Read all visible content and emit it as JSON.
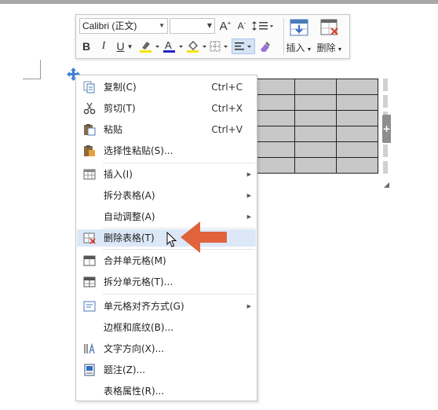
{
  "toolbar": {
    "font_name": "Calibri (正文)",
    "font_size": "",
    "bold": "B",
    "italic": "I",
    "underline": "U",
    "font_color_letter": "A",
    "grow_font": "A",
    "shrink_font": "A",
    "insert_label": "插入",
    "delete_label": "删除",
    "font_color_hex": "#2222cc",
    "highlight_hex": "#f5e400",
    "shading_hex": "#f5e400"
  },
  "menu": {
    "items": [
      {
        "label": "复制(C)",
        "shortcut": "Ctrl+C",
        "icon": "copy-icon"
      },
      {
        "label": "剪切(T)",
        "shortcut": "Ctrl+X",
        "icon": "cut-icon"
      },
      {
        "label": "粘贴",
        "shortcut": "Ctrl+V",
        "icon": "paste-icon"
      },
      {
        "label": "选择性粘贴(S)...",
        "icon": "paste-special-icon"
      },
      {
        "label": "插入(I)",
        "icon": "insert-table-icon",
        "submenu": true
      },
      {
        "label": "拆分表格(A)",
        "submenu": true
      },
      {
        "label": "自动调整(A)",
        "submenu": true
      },
      {
        "label": "删除表格(T)",
        "icon": "delete-table-icon",
        "highlighted": true
      },
      {
        "label": "合并单元格(M)",
        "icon": "merge-cells-icon"
      },
      {
        "label": "拆分单元格(T)...",
        "icon": "split-cells-icon"
      },
      {
        "label": "单元格对齐方式(G)",
        "icon": "cell-alignment-icon",
        "submenu": true
      },
      {
        "label": "边框和底纹(B)..."
      },
      {
        "label": "文字方向(X)...",
        "icon": "text-direction-icon"
      },
      {
        "label": "题注(Z)...",
        "icon": "caption-icon"
      },
      {
        "label": "表格属性(R)..."
      }
    ]
  },
  "table": {
    "rows": 6,
    "cols": 3,
    "cell_color": "#c8c8c8"
  },
  "accent": {
    "highlight_bg": "#dce8f8",
    "arrow_color": "#e0633c",
    "delete_red": "#d93a2b"
  }
}
